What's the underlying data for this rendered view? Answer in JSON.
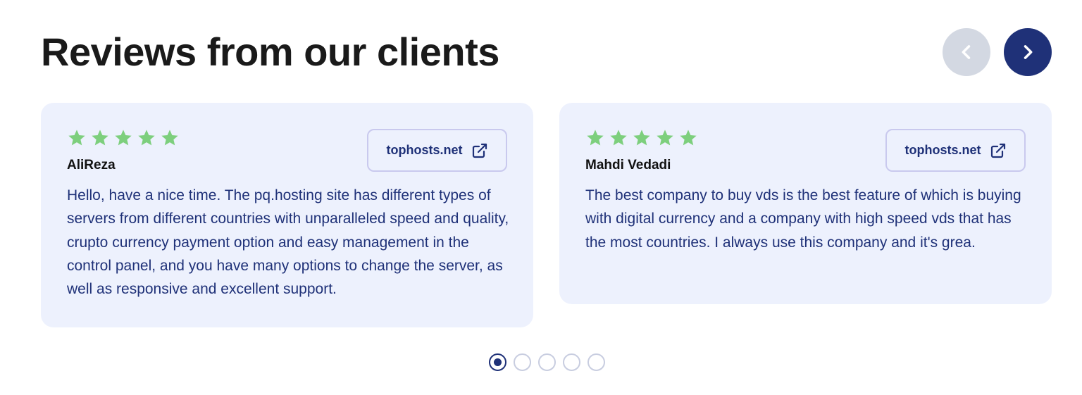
{
  "section": {
    "title": "Reviews from our clients"
  },
  "navigation": {
    "prev_icon": "chevron-left-icon",
    "next_icon": "chevron-right-icon",
    "prev_color": "#d3d8e2",
    "next_color": "#1f3178"
  },
  "reviews": [
    {
      "rating": 5,
      "reviewer": "AliReza",
      "source": "tophosts.net",
      "source_icon": "external-link-icon",
      "text": "Hello, have a nice time. The pq.hosting site has different types of servers from different countries with unparalleled speed and quality, crupto currency payment option and easy management in the control panel, and you have many options to change the server, as well as responsive and excellent support."
    },
    {
      "rating": 5,
      "reviewer": "Mahdi Vedadi",
      "source": "tophosts.net",
      "source_icon": "external-link-icon",
      "text": "The best company to buy vds is the best feature of which is buying with digital currency and a company with high speed vds that has the most countries. I always use this company and it's grea."
    }
  ],
  "pagination": {
    "total": 5,
    "active": 1
  },
  "colors": {
    "star": "#7dcf7d",
    "accent": "#1f3178",
    "card_background": "#edf1fd"
  }
}
